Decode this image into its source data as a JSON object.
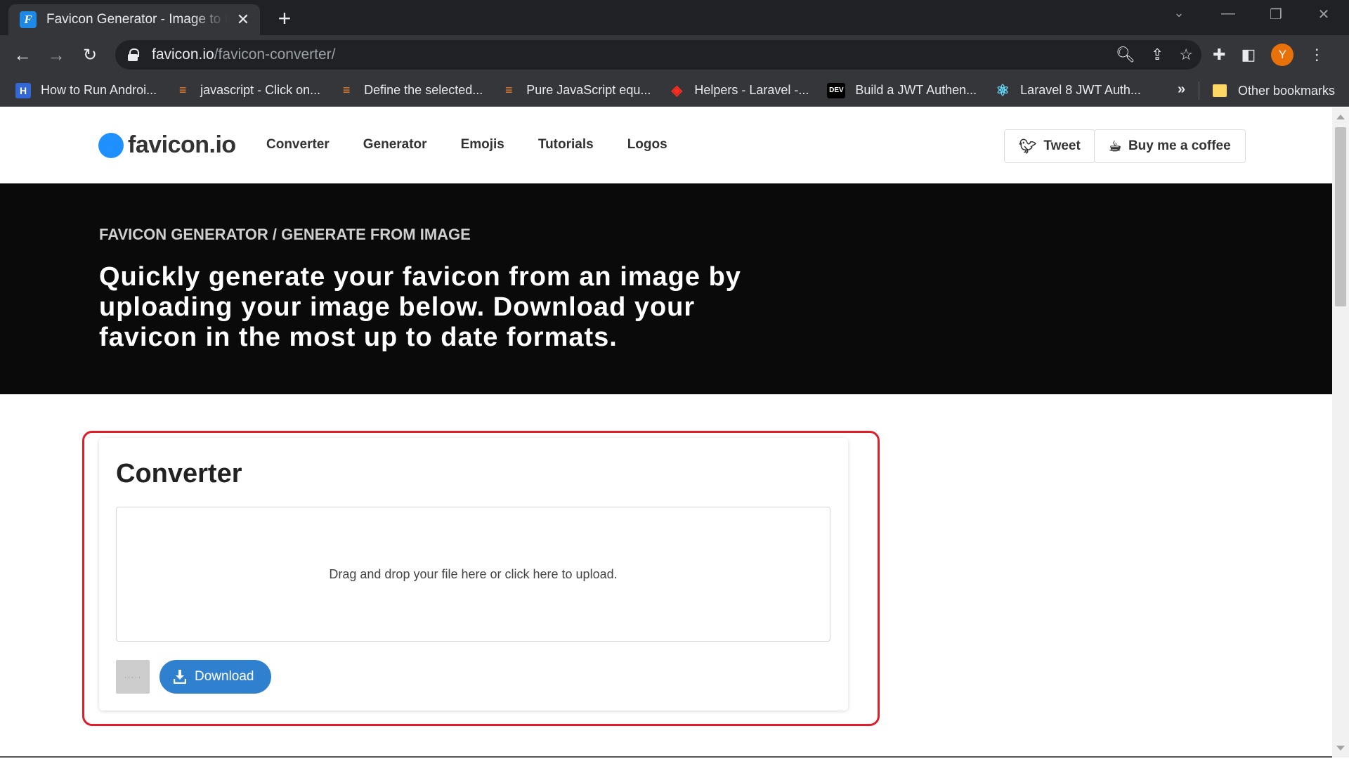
{
  "browser": {
    "tab_title": "Favicon Generator - Image to Favicon",
    "tab_favicon_letter": "F",
    "url_domain": "favicon.io",
    "url_path": "/favicon-converter/",
    "avatar_letter": "Y",
    "bookmarks": [
      {
        "label": "How to Run Androi...",
        "icon": "H",
        "color": "#3367d6"
      },
      {
        "label": "javascript - Click on...",
        "icon": "≡",
        "color": "#f48024"
      },
      {
        "label": "Define the selected...",
        "icon": "≡",
        "color": "#f48024"
      },
      {
        "label": "Pure JavaScript equ...",
        "icon": "≡",
        "color": "#f48024"
      },
      {
        "label": "Helpers - Laravel -...",
        "icon": "◈",
        "color": "#ff2d20"
      },
      {
        "label": "Build a JWT Authen...",
        "icon": "DEV",
        "color": "#000000"
      },
      {
        "label": "Laravel 8 JWT Auth...",
        "icon": "⚛",
        "color": "#61dafb"
      }
    ],
    "more_bookmarks": "»",
    "other_bookmarks": "Other bookmarks"
  },
  "site": {
    "logo": "favicon.io",
    "nav": [
      "Converter",
      "Generator",
      "Emojis",
      "Tutorials",
      "Logos"
    ],
    "tweet": "Tweet",
    "coffee": "Buy me a coffee"
  },
  "hero": {
    "eyebrow": "FAVICON GENERATOR / GENERATE FROM IMAGE",
    "lead": "Quickly generate your favicon from an image by uploading your image below. Download your favicon in the most up to date formats."
  },
  "converter": {
    "title": "Converter",
    "dropzone_text": "Drag and drop your file here or click here to upload.",
    "placeholder_dots": "·····",
    "download_label": "Download"
  },
  "colors": {
    "accent": "#2f80cf",
    "logo_dot": "#1e90ff",
    "highlight": "#e11d2a",
    "hero_bg": "#0a0a0a"
  }
}
